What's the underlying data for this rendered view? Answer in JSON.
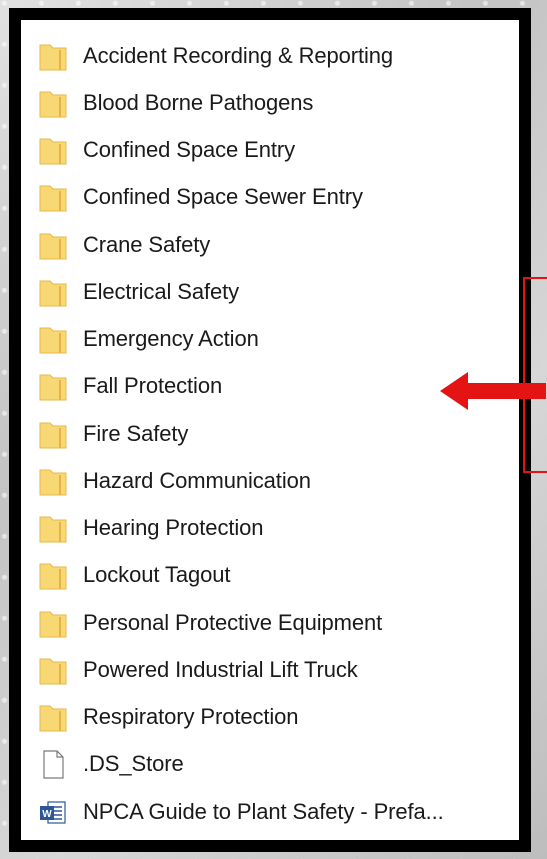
{
  "items": [
    {
      "type": "folder",
      "label": "Accident Recording & Reporting"
    },
    {
      "type": "folder",
      "label": "Blood Borne Pathogens"
    },
    {
      "type": "folder",
      "label": "Confined Space Entry"
    },
    {
      "type": "folder",
      "label": "Confined Space Sewer Entry"
    },
    {
      "type": "folder",
      "label": "Crane Safety"
    },
    {
      "type": "folder",
      "label": "Electrical Safety"
    },
    {
      "type": "folder",
      "label": "Emergency Action"
    },
    {
      "type": "folder",
      "label": "Fall Protection"
    },
    {
      "type": "folder",
      "label": "Fire Safety"
    },
    {
      "type": "folder",
      "label": "Hazard Communication"
    },
    {
      "type": "folder",
      "label": "Hearing Protection"
    },
    {
      "type": "folder",
      "label": "Lockout Tagout"
    },
    {
      "type": "folder",
      "label": "Personal Protective Equipment"
    },
    {
      "type": "folder",
      "label": "Powered Industrial Lift Truck"
    },
    {
      "type": "folder",
      "label": "Respiratory Protection"
    },
    {
      "type": "file",
      "label": ".DS_Store"
    },
    {
      "type": "word",
      "label": "NPCA Guide to Plant Safety - Prefa..."
    }
  ],
  "colors": {
    "folder_fill": "#f8d775",
    "folder_edge": "#e7b84a",
    "arrow": "#e41414"
  },
  "icons": {
    "folder": "folder-icon",
    "file": "blank-file-icon",
    "word": "word-document-icon"
  }
}
